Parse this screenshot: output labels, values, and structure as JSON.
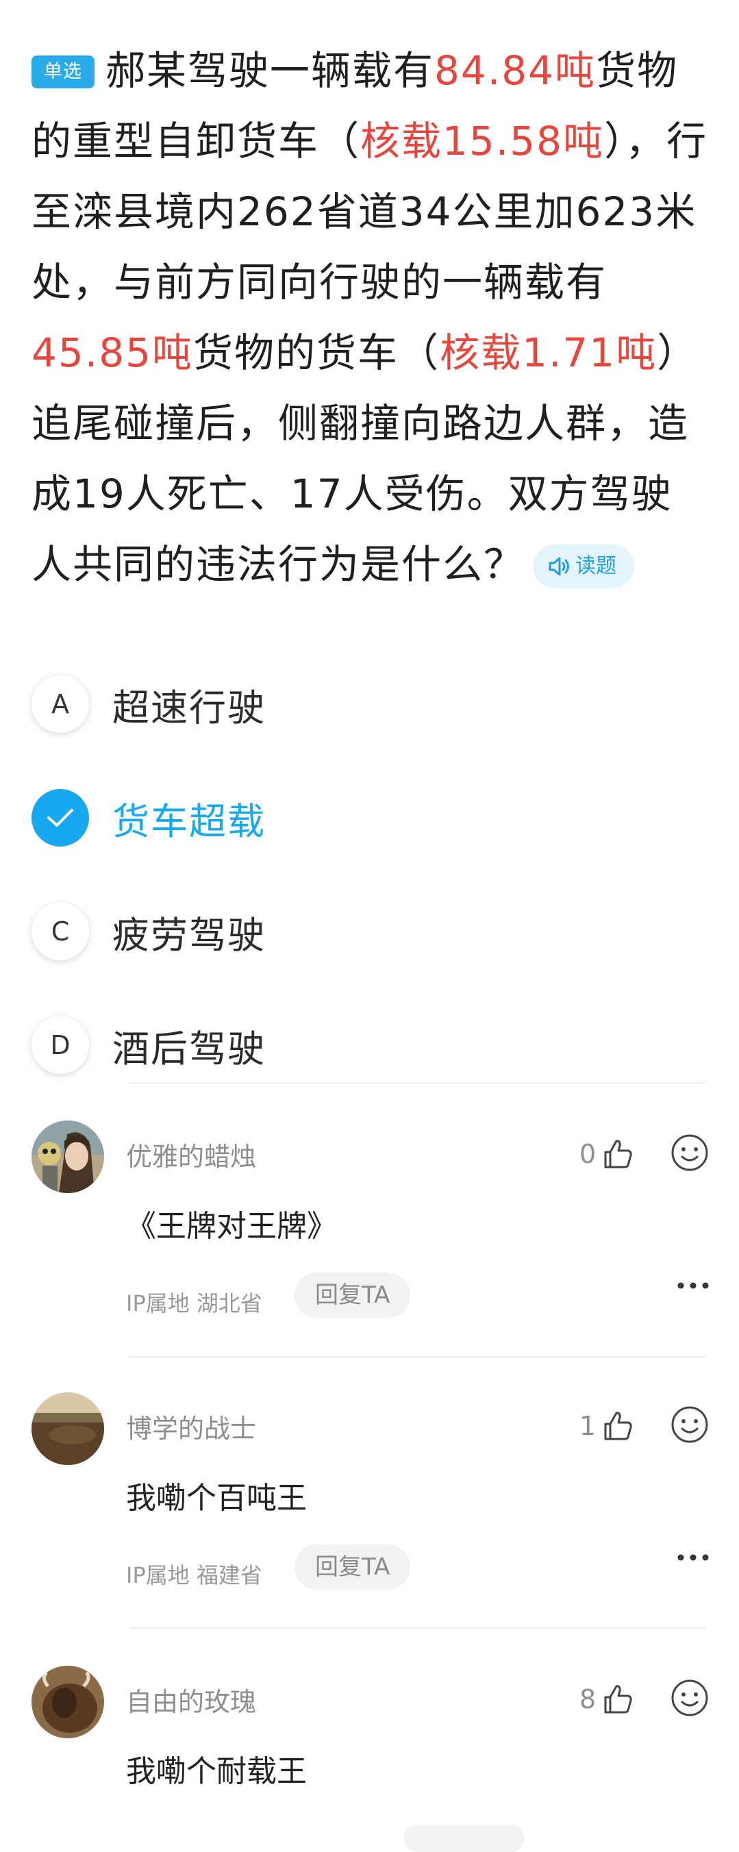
{
  "question": {
    "type_tag": "单选",
    "parts": [
      {
        "text": "郝某驾驶一辆载有",
        "highlight": false
      },
      {
        "text": "84.84吨",
        "highlight": true
      },
      {
        "text": "货物的重型自卸货车（",
        "highlight": false
      },
      {
        "text": "核载15.58吨",
        "highlight": true
      },
      {
        "text": "），行至滦县境内262省道34公里加623米处，与前方同向行驶的一辆载有",
        "highlight": false
      },
      {
        "text": "45.85吨",
        "highlight": true
      },
      {
        "text": "货物的货车（",
        "highlight": false
      },
      {
        "text": "核载1.71吨",
        "highlight": true
      },
      {
        "text": "）追尾碰撞后，侧翻撞向路边人群，造成19人死亡、17人受伤。双方驾驶人共同的违法行为是什么？",
        "highlight": false
      }
    ],
    "read_button": "读题"
  },
  "options": [
    {
      "letter": "A",
      "text": "超速行驶",
      "selected": false
    },
    {
      "letter": "B",
      "text": "货车超载",
      "selected": true
    },
    {
      "letter": "C",
      "text": "疲劳驾驶",
      "selected": false
    },
    {
      "letter": "D",
      "text": "酒后驾驶",
      "selected": false
    }
  ],
  "comments": [
    {
      "name": "优雅的蜡烛",
      "text": "《王牌对王牌》",
      "ip": "IP属地 湖北省",
      "reply": "回复TA",
      "likes": "0"
    },
    {
      "name": "博学的战士",
      "text": "我嘞个百吨王",
      "ip": "IP属地 福建省",
      "reply": "回复TA",
      "likes": "1"
    },
    {
      "name": "自由的玫瑰",
      "text": "我嘞个耐载王",
      "ip": "",
      "reply": "",
      "likes": "8"
    }
  ],
  "colors": {
    "accent": "#17a8ef",
    "highlight": "#e5473f",
    "secondary_text": "#8e8e8e"
  },
  "icons": [
    "speaker-icon",
    "check-icon",
    "thumbs-up-icon",
    "smiley-icon",
    "more-dots-icon"
  ]
}
